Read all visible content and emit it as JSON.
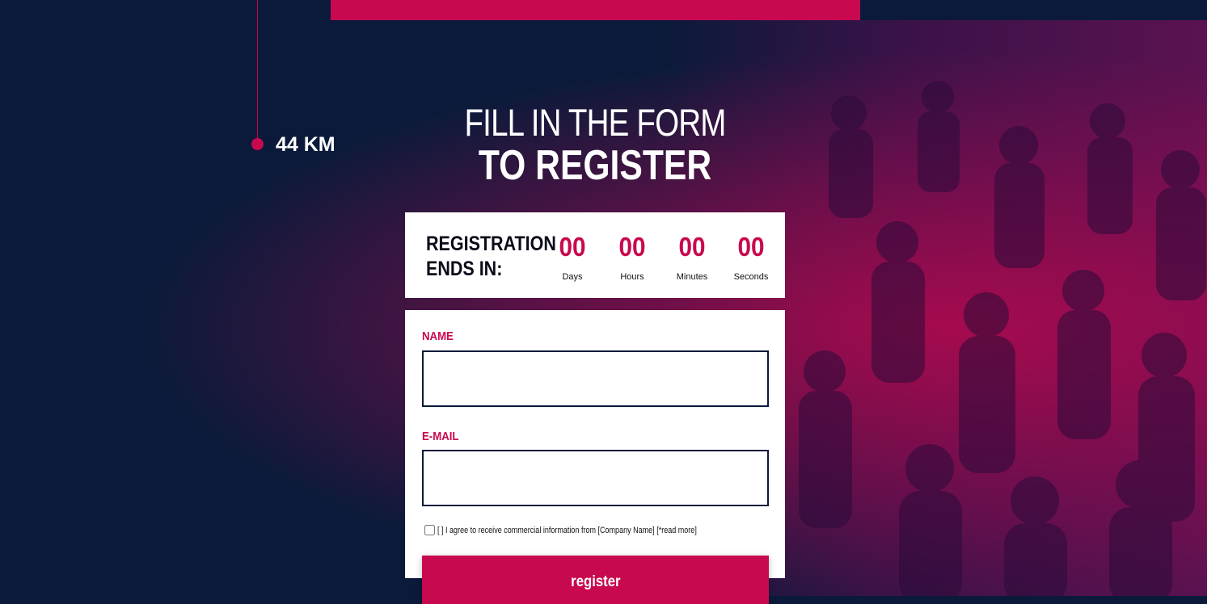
{
  "route": {
    "distance_label": "44 KM"
  },
  "headline": {
    "line1": "FILL IN THE FORM",
    "line2": "TO REGISTER"
  },
  "countdown": {
    "label_line1": "REGISTRATION",
    "label_line2": "ENDS IN:",
    "units": [
      {
        "value": "00",
        "caption": "Days"
      },
      {
        "value": "00",
        "caption": "Hours"
      },
      {
        "value": "00",
        "caption": "Minutes"
      },
      {
        "value": "00",
        "caption": "Seconds"
      }
    ]
  },
  "form": {
    "name_label": "NAME",
    "name_value": "",
    "email_label": "E-MAIL",
    "email_value": "",
    "consent_text": "[ ] I agree to receive commercial information from [Company Name] [*read more]",
    "submit_label": "register"
  },
  "colors": {
    "accent": "#c8084f",
    "background": "#0b1a3a",
    "card": "#ffffff"
  }
}
